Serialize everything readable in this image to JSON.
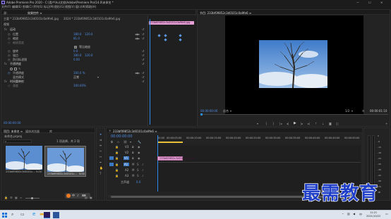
{
  "app": {
    "title": "Adobe Premiere Pro 2020 - C:\\用户\\hu\\文档\\Adobe\\Premiere Pro\\14.0\\未命名 *",
    "menu": [
      "文件(F)",
      "编辑(E)",
      "剪辑(C)",
      "序列(S)",
      "标记(M)",
      "图形(G)",
      "视图(V)",
      "窗口(W)",
      "帮助(H)"
    ],
    "window_controls": [
      "—",
      "☐",
      "✕"
    ]
  },
  "effect_controls": {
    "tabs": [
      "源：",
      "效果控件 ≡"
    ],
    "source_label": "主要 * 233bf09852c3d0101c0a9fe6.jpg",
    "clip_label": "2024 * 233bf09852c3d0101c0a9fe6.jpg",
    "clip_bar": "233bf09852c3d0101c0a9fe6.jpg",
    "section_video": "视频",
    "motion": "运动",
    "position_label": "位置",
    "position_x": "180.0",
    "position_y": "120.0",
    "scale_label": "缩放",
    "scale_value": "81.0",
    "scale_width_label": "缩放宽度",
    "uniform_scale_label": "等比缩放",
    "rotation_label": "旋转",
    "rotation_value": "0.0",
    "anchor_label": "锚点",
    "anchor_x": "180.0",
    "anchor_y": "120.0",
    "flicker_label": "防闪烁滤镜",
    "flicker_value": "0.00",
    "opacity_label": "不透明度",
    "opacity_value": "100.0 %",
    "blend_label": "混合模式",
    "blend_value": "正常",
    "time_remap_label": "时间重映射",
    "speed_label": "速度",
    "speed_value": "100.00%",
    "timecode": "00:00:00:00"
  },
  "program_monitor": {
    "tab": "节目: 233bf09852c3d0101c0a9fe6 ≡",
    "timecode_left": "00:00:00:00",
    "fit": "适合",
    "quality": "1/2",
    "timecode_right": "00:00:01:10"
  },
  "project_panel": {
    "tabs": [
      "项目: 未命名 ≡",
      "媒体浏览器",
      "库"
    ],
    "project_file": "未命名.prproj",
    "item_count": "1 项选择，共 2 项",
    "items": [
      {
        "name": "233bf09852c3d0101c...",
        "duration": "5:00"
      },
      {
        "name": "233bf09852c3d0101c...",
        "duration": "5:00"
      }
    ]
  },
  "timeline": {
    "tab": "233bf09852c3d0101c0a9fe6 ≡",
    "timecode": "00:00:00:00",
    "ruler": [
      "00:00",
      "00:00:05:00",
      "00:00:10:00",
      "00:00:15:00",
      "00:00:20:00",
      "00:00:25:00",
      "00:00:30:00",
      "00:00:35:00",
      "00:00:40:00",
      "00:00:45:00",
      "00:00:50:00"
    ],
    "tracks_video": [
      "V3",
      "V2",
      "V1"
    ],
    "tracks_audio": [
      "A1",
      "A2",
      "A3"
    ],
    "master_label": "主声道",
    "master_value": "0.0",
    "clip_label": "233bf09852c3d0101c0a9fe6"
  },
  "audio_meter": {
    "scale": [
      "0",
      "-6",
      "-12",
      "-18",
      "-24",
      "-30",
      "-36",
      "-42",
      "-48",
      "-54"
    ],
    "unit": "dB",
    "buttons": [
      "S",
      "S"
    ]
  },
  "watermark": "最需教育",
  "taskbar": {
    "time": "11:21",
    "date": "2021/10/22",
    "ime": "中"
  },
  "colors": {
    "accent": "#2d8ceb",
    "clip_pink": "#e59fd4",
    "timecode_blue": "#4f8fe8",
    "watermark_blue": "#1f3fc8"
  }
}
